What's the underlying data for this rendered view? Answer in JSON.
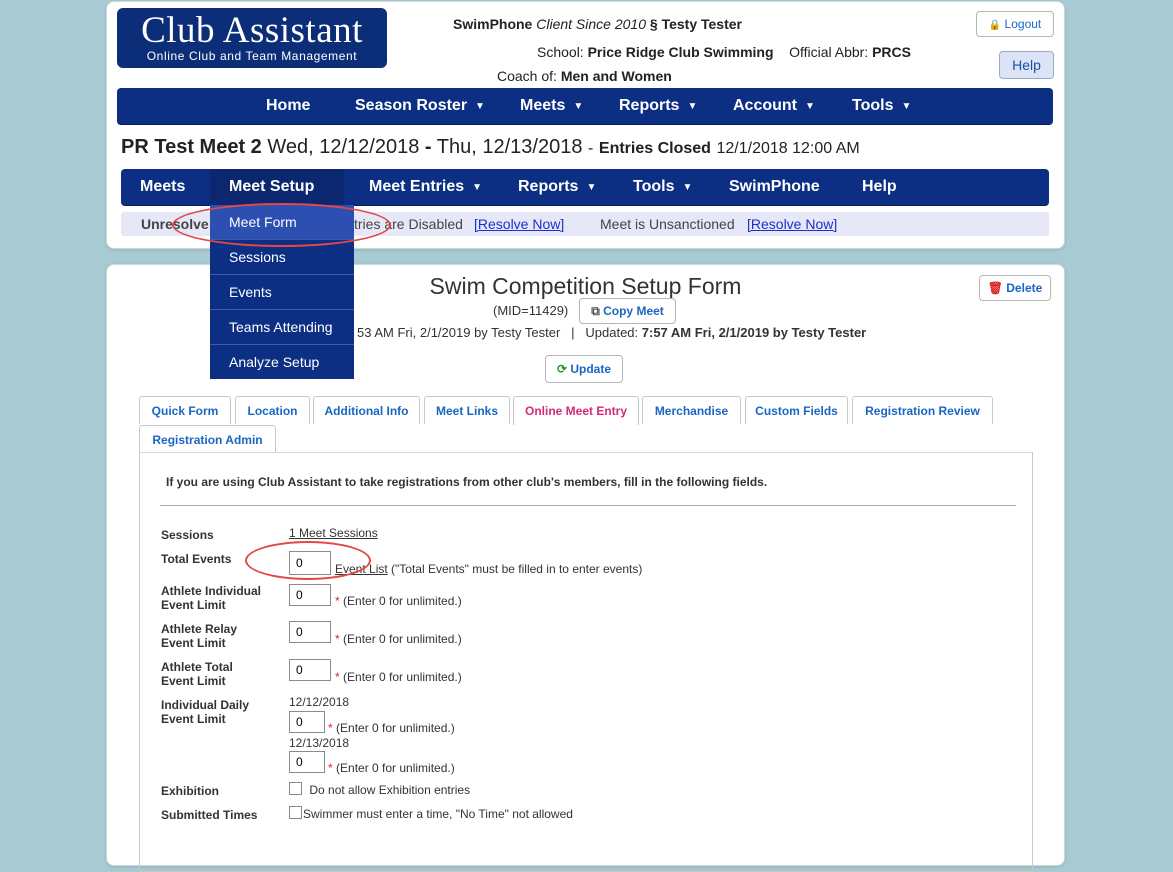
{
  "header": {
    "logo_title": "Club Assistant",
    "logo_subtitle": "Online Club and Team Management",
    "product": "SwimPhone",
    "client_since": "Client Since 2010",
    "section_sign": "§",
    "user": "Testy Tester",
    "school_label": "School:",
    "school": "Price Ridge Club Swimming",
    "abbr_label": "Official Abbr:",
    "abbr": "PRCS",
    "coach_label": "Coach of:",
    "coach": "Men and Women",
    "logout_label": "Logout",
    "help_label": "Help"
  },
  "main_nav": [
    "Home",
    "Season Roster",
    "Meets",
    "Reports",
    "Account",
    "Tools"
  ],
  "meet": {
    "name": "PR Test Meet 2",
    "start": "Wed, 12/12/2018",
    "dash": "-",
    "end": "Thu, 12/13/2018",
    "sep": "-",
    "status": "Entries Closed",
    "status_date": "12/1/2018 12:00 AM"
  },
  "meet_nav": [
    "Meets",
    "Meet Setup",
    "Meet Entries",
    "Reports",
    "Tools",
    "SwimPhone",
    "Help"
  ],
  "warnings": {
    "prefix": "Unresolve",
    "w1": "tries are Disabled",
    "resolve1": "[Resolve Now]",
    "w2": "Meet is Unsanctioned",
    "resolve2": "[Resolve Now]"
  },
  "dropdown": [
    "Meet Form",
    "Sessions",
    "Events",
    "Teams Attending",
    "Analyze Setup"
  ],
  "form": {
    "title": "Swim Competition Setup Form",
    "mid": "(MID=11429)",
    "copy_label": "Copy Meet",
    "delete_label": "Delete",
    "created": "53 AM Fri, 2/1/2019 by Testy Tester",
    "pipe": "|",
    "updated_label": "Updated:",
    "updated": "7:57 AM Fri, 2/1/2019 by Testy Tester",
    "update_label": "Update"
  },
  "tabs": [
    "Quick Form",
    "Location",
    "Additional Info",
    "Meet Links",
    "Online Meet Entry",
    "Merchandise",
    "Custom Fields",
    "Registration Review",
    "Registration Admin"
  ],
  "active_tab": "Online Meet Entry",
  "panel": {
    "intro": "If you are using Club Assistant to take registrations from other club's members, fill in the following fields.",
    "sessions_label": "Sessions",
    "sessions_link": "1 Meet Sessions",
    "total_events_label": "Total Events",
    "total_events_value": "0",
    "event_list_link": "Event List",
    "total_events_note": "(\"Total Events\" must be filled in to enter events)",
    "ind_limit_label1": "Athlete Individual",
    "ind_limit_label2": "Event Limit",
    "ind_limit_value": "0",
    "relay_limit_label1": "Athlete Relay",
    "relay_limit_label2": "Event Limit",
    "relay_limit_value": "0",
    "total_limit_label1": "Athlete Total",
    "total_limit_label2": "Event Limit",
    "total_limit_value": "0",
    "star": "*",
    "unlimited_note": "(Enter 0 for unlimited.)",
    "daily_label1": "Individual Daily",
    "daily_label2": "Event Limit",
    "day1": "12/12/2018",
    "day1_value": "0",
    "day2": "12/13/2018",
    "day2_value": "0",
    "exhibition_label": "Exhibition",
    "exhibition_text": "Do not allow Exhibition entries",
    "submitted_label": "Submitted Times",
    "submitted_text": "Swimmer must enter a time, \"No Time\" not allowed"
  },
  "colors": {
    "nav_bg": "#0c2f84",
    "background": "#a8cad3",
    "active_tab": "#d6287a",
    "callout": "#e24848"
  }
}
